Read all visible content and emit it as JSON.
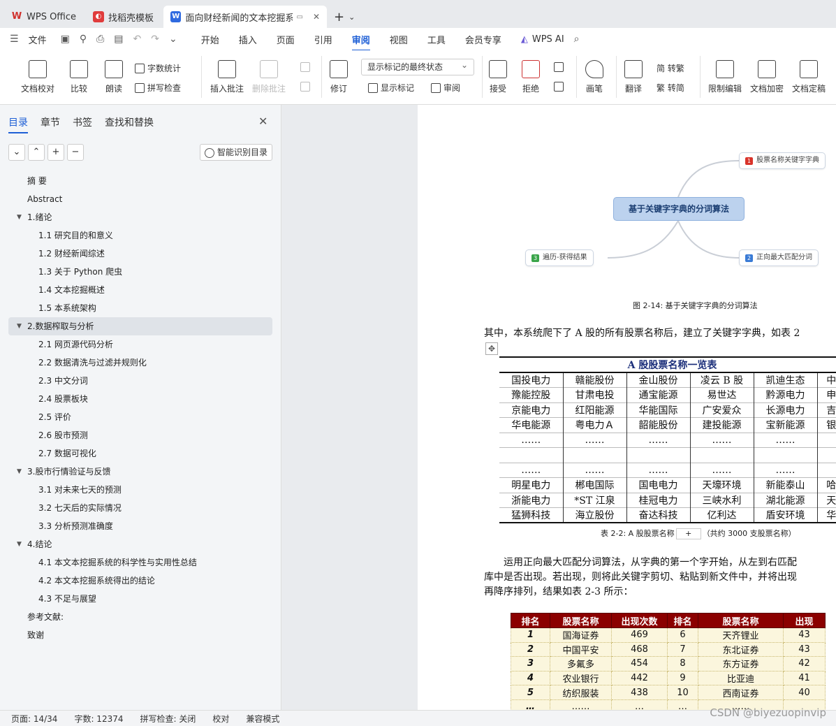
{
  "tabs": [
    {
      "label": "WPS Office",
      "logo": "W",
      "color": "#d0312d"
    },
    {
      "label": "找稻壳模板",
      "logo": "◐",
      "color": "#e03c3c"
    },
    {
      "label": "面向财经新闻的文本挖掘系统",
      "logo": "W",
      "color": "#2f6ae0"
    }
  ],
  "menu": {
    "file": "文件",
    "items": [
      "开始",
      "插入",
      "页面",
      "引用",
      "审阅",
      "视图",
      "工具",
      "会员专享"
    ],
    "selected": "审阅",
    "ai": "WPS AI"
  },
  "ribbon": {
    "proof": "文档校对",
    "compare": "比较",
    "read": "朗读",
    "wordcount": "字数统计",
    "spell": "拼写检查",
    "add_comment": "插入批注",
    "delete_comment": "删除批注",
    "revise": "修订",
    "markup_state": "显示标记的最终状态",
    "show_markup": "显示标记",
    "review": "审阅",
    "accept": "接受",
    "reject": "拒绝",
    "pen": "画笔",
    "translate": "翻译",
    "to_trad": "简 转繁",
    "to_simp": "繁 转简",
    "restrict": "限制编辑",
    "encrypt": "文档加密",
    "finalize": "文档定稿"
  },
  "sidebar": {
    "tabs": [
      "目录",
      "章节",
      "书签",
      "查找和替换"
    ],
    "smart_toc": "智能识别目录",
    "toc": [
      {
        "text": "摘  要",
        "lvl": 1
      },
      {
        "text": "Abstract",
        "lvl": 1
      },
      {
        "text": "1.绪论",
        "lvl": 0
      },
      {
        "text": "1.1  研究目的和意义",
        "lvl": 2
      },
      {
        "text": "1.2  财经新闻综述",
        "lvl": 2
      },
      {
        "text": "1.3  关于 Python 爬虫",
        "lvl": 2
      },
      {
        "text": "1.4  文本挖掘概述",
        "lvl": 2
      },
      {
        "text": "1.5 本系统架构",
        "lvl": 2
      },
      {
        "text": "2.数据榨取与分析",
        "lvl": 0,
        "hl": true
      },
      {
        "text": "2.1  网页源代码分析",
        "lvl": 2
      },
      {
        "text": "2.2  数据清洗与过滤并规则化",
        "lvl": 2
      },
      {
        "text": "2.3  中文分词",
        "lvl": 2
      },
      {
        "text": "2.4  股票板块",
        "lvl": 2
      },
      {
        "text": "2.5  评价",
        "lvl": 2
      },
      {
        "text": "2.6  股市预测",
        "lvl": 2
      },
      {
        "text": "2.7  数据可视化",
        "lvl": 2
      },
      {
        "text": "3.股市行情验证与反馈",
        "lvl": 0
      },
      {
        "text": "3.1  对未来七天的预测",
        "lvl": 2
      },
      {
        "text": "3.2  七天后的实际情况",
        "lvl": 2
      },
      {
        "text": "3.3  分析预测准确度",
        "lvl": 2
      },
      {
        "text": "4.结论",
        "lvl": 0
      },
      {
        "text": "4.1  本文本挖掘系统的科学性与实用性总结",
        "lvl": 2
      },
      {
        "text": "4.2  本文本挖掘系统得出的结论",
        "lvl": 2
      },
      {
        "text": "4.3  不足与展望",
        "lvl": 2
      },
      {
        "text": "参考文献:",
        "lvl": 1
      },
      {
        "text": "致谢",
        "lvl": 1
      }
    ]
  },
  "doc": {
    "mindmap": {
      "center": "基于关键字字典的分词算法",
      "nodes": [
        {
          "n": "1",
          "text": "股票名称关键字字典",
          "color": "#d9342b"
        },
        {
          "n": "2",
          "text": "正向最大匹配分词",
          "color": "#3a7bd5"
        },
        {
          "n": "3",
          "text": "遍历-获得结果",
          "color": "#3aa54a"
        }
      ]
    },
    "fig_caption": "图 2-14: 基于关键字字典的分词算法",
    "para1": "其中，本系统爬下了 A 股的所有股票名称后，建立了关键字字典，如表 2",
    "table1": {
      "title": "A 股股票名称一览表",
      "rows": [
        [
          "国投电力",
          "赣能股份",
          "金山股份",
          "凌云 B 股",
          "凯迪生态",
          "中"
        ],
        [
          "豫能控股",
          "甘肃电投",
          "通宝能源",
          "易世达",
          "黔源电力",
          "申"
        ],
        [
          "京能电力",
          "红阳能源",
          "华能国际",
          "广安爱众",
          "长源电力",
          "吉"
        ],
        [
          "华电能源",
          "粤电力Ａ",
          "韶能股份",
          "建投能源",
          "宝新能源",
          "银"
        ],
        [
          "……",
          "……",
          "……",
          "……",
          "……",
          ""
        ],
        [
          "",
          "",
          "",
          "",
          "",
          ""
        ],
        [
          "……",
          "……",
          "……",
          "……",
          "……",
          ""
        ],
        [
          "明星电力",
          "郴电国际",
          "国电电力",
          "天壕环境",
          "新能泰山",
          "哈"
        ],
        [
          "浙能电力",
          "*ST 江泉",
          "桂冠电力",
          "三峡水利",
          "湖北能源",
          "天"
        ],
        [
          "猛狮科技",
          "海立股份",
          "奋达科技",
          "亿利达",
          "盾安环境",
          "华"
        ]
      ]
    },
    "table1_caption_a": "表 2-2: A 股股票名称",
    "table1_caption_b": "（共约 3000 支股票名称）",
    "para2": "运用正向最大匹配分词算法，从字典的第一个字开始，从左到右匹配",
    "para3": "库中是否出现。若出现，则将此关键字剪切、粘贴到新文件中，并将出现",
    "para4": "再降序排列，结果如表 2-3 所示：",
    "table2": {
      "headers": [
        "排名",
        "股票名称",
        "出现次数",
        "排名",
        "股票名称",
        "出现"
      ],
      "rows": [
        [
          "1",
          "国海证券",
          "469",
          "6",
          "天齐锂业",
          "43"
        ],
        [
          "2",
          "中国平安",
          "468",
          "7",
          "东北证券",
          "43"
        ],
        [
          "3",
          "多氟多",
          "454",
          "8",
          "东方证券",
          "42"
        ],
        [
          "4",
          "农业银行",
          "442",
          "9",
          "比亚迪",
          "41"
        ],
        [
          "5",
          "纺织服装",
          "438",
          "10",
          "西南证券",
          "40"
        ],
        [
          "…",
          "……",
          "…",
          "…",
          "……",
          ""
        ]
      ]
    }
  },
  "status": {
    "page": "页面: 14/34",
    "words": "字数: 12374",
    "spell": "拼写检查: 关闭",
    "proof": "校对",
    "compat": "兼容模式"
  },
  "watermark": "CSDN @biyezuopinvip"
}
